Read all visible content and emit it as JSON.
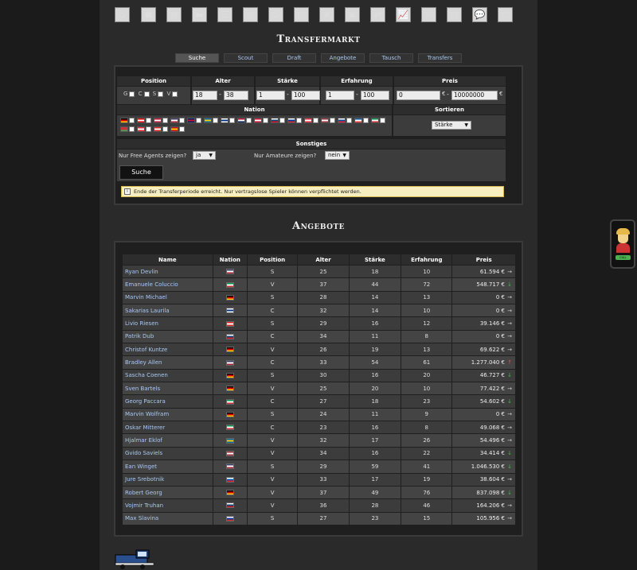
{
  "nav": {
    "icons": [
      {
        "name": "home-icon",
        "glyph": "⌂"
      },
      {
        "name": "team-icon",
        "glyph": "☗"
      },
      {
        "name": "lineup-icon",
        "glyph": "▦"
      },
      {
        "name": "training-icon",
        "glyph": "▬"
      },
      {
        "name": "list-icon",
        "glyph": "☰"
      },
      {
        "name": "scouting-icon",
        "glyph": "◎"
      },
      {
        "name": "youth-icon",
        "glyph": "☺"
      },
      {
        "name": "arena-icon",
        "glyph": "▤"
      },
      {
        "name": "trophy-icon",
        "glyph": "♛"
      },
      {
        "name": "tv-icon",
        "glyph": "▣"
      },
      {
        "name": "transfer-icon",
        "glyph": "⇄"
      },
      {
        "name": "stats-icon",
        "glyph": "📈"
      },
      {
        "name": "mail-icon",
        "glyph": "✉"
      },
      {
        "name": "news-icon",
        "glyph": "▥"
      },
      {
        "name": "forum-icon",
        "glyph": "💬"
      },
      {
        "name": "logout-icon",
        "glyph": "⏻"
      }
    ]
  },
  "title": "Transfermarkt",
  "tabs": [
    {
      "label": "Suche",
      "active": true
    },
    {
      "label": "Scout",
      "active": false
    },
    {
      "label": "Draft",
      "active": false
    },
    {
      "label": "Angebote",
      "active": false
    },
    {
      "label": "Tausch",
      "active": false
    },
    {
      "label": "Transfers",
      "active": false
    }
  ],
  "search": {
    "headers": {
      "position": "Position",
      "alter": "Alter",
      "staerke": "Stärke",
      "erfahrung": "Erfahrung",
      "preis": "Preis",
      "nation": "Nation",
      "sortieren": "Sortieren",
      "sonstiges": "Sonstiges"
    },
    "positions": [
      "G",
      "C",
      "S",
      "V"
    ],
    "alter_min": "18",
    "alter_max": "38",
    "staerke_min": "1",
    "staerke_max": "100",
    "erfahrung_min": "1",
    "erfahrung_max": "100",
    "preis_min": "0",
    "preis_max": "10000000",
    "currency": "€",
    "dash": "-",
    "sort_value": "Stärke",
    "free_agents_label": "Nur Free Agents zeigen?",
    "free_agents_value": "ja",
    "amateure_label": "Nur Amateure zeigen?",
    "amateure_value": "nein",
    "button": "Suche",
    "notice": "Ende der Transferperiode erreicht. Nur vertragslose Spieler können verpflichtet werden.",
    "info_glyph": "i"
  },
  "nation_flags": [
    {
      "code": "DE",
      "colors": [
        "#000",
        "#d00",
        "#fc0"
      ]
    },
    {
      "code": "CA",
      "colors": [
        "#d00",
        "#fff",
        "#d00"
      ]
    },
    {
      "code": "DK",
      "colors": [
        "#c60c30",
        "#fff",
        "#c60c30"
      ]
    },
    {
      "code": "US",
      "colors": [
        "#3c3b6e",
        "#fff",
        "#b22234"
      ]
    },
    {
      "code": "GB",
      "colors": [
        "#012169",
        "#c8102e",
        "#012169"
      ]
    },
    {
      "code": "SE",
      "colors": [
        "#006aa7",
        "#fecc00",
        "#006aa7"
      ]
    },
    {
      "code": "FI",
      "colors": [
        "#fff",
        "#003580",
        "#fff"
      ]
    },
    {
      "code": "NO",
      "colors": [
        "#ba0c2f",
        "#fff",
        "#00205b"
      ]
    },
    {
      "code": "DK2",
      "colors": [
        "#c60c30",
        "#fff",
        "#c60c30"
      ]
    },
    {
      "code": "CZ",
      "colors": [
        "#fff",
        "#11457e",
        "#d7141a"
      ]
    },
    {
      "code": "RU",
      "colors": [
        "#fff",
        "#0039a6",
        "#d52b1e"
      ]
    },
    {
      "code": "AT",
      "colors": [
        "#ed2939",
        "#fff",
        "#ed2939"
      ]
    },
    {
      "code": "LV",
      "colors": [
        "#9e3039",
        "#fff",
        "#9e3039"
      ]
    },
    {
      "code": "SK",
      "colors": [
        "#fff",
        "#0b4ea2",
        "#ee1c25"
      ]
    },
    {
      "code": "FR",
      "colors": [
        "#0055a4",
        "#fff",
        "#ef4135"
      ]
    },
    {
      "code": "IT",
      "colors": [
        "#009246",
        "#fff",
        "#ce2b37"
      ]
    },
    {
      "code": "BY",
      "colors": [
        "#c8313e",
        "#c8313e",
        "#4aa657"
      ]
    },
    {
      "code": "AT2",
      "colors": [
        "#ed2939",
        "#fff",
        "#ed2939"
      ]
    },
    {
      "code": "CH",
      "colors": [
        "#d52b1e",
        "#fff",
        "#d52b1e"
      ]
    },
    {
      "code": "ES",
      "colors": [
        "#c60b1e",
        "#ffc400",
        "#c60b1e"
      ]
    }
  ],
  "offers": {
    "title": "Angebote",
    "columns": [
      "Name",
      "Nation",
      "Position",
      "Alter",
      "Stärke",
      "Erfahrung",
      "Preis"
    ],
    "rows": [
      {
        "name": "Ryan Devlin",
        "flag": "US",
        "pos": "S",
        "alter": "25",
        "staerke": "18",
        "erf": "10",
        "preis": "61.594 €",
        "trend": "→"
      },
      {
        "name": "Emanuele Coluccio",
        "flag": "IT",
        "pos": "V",
        "alter": "37",
        "staerke": "44",
        "erf": "72",
        "preis": "548.717 €",
        "trend": "↓"
      },
      {
        "name": "Marvin Michael",
        "flag": "DE",
        "pos": "S",
        "alter": "28",
        "staerke": "14",
        "erf": "13",
        "preis": "0 €",
        "trend": "→"
      },
      {
        "name": "Sakarias Laurila",
        "flag": "FI",
        "pos": "C",
        "alter": "32",
        "staerke": "14",
        "erf": "10",
        "preis": "0 €",
        "trend": "→"
      },
      {
        "name": "Livio Riesen",
        "flag": "CH",
        "pos": "S",
        "alter": "29",
        "staerke": "16",
        "erf": "12",
        "preis": "39.146 €",
        "trend": "→"
      },
      {
        "name": "Patrik Dub",
        "flag": "CZ",
        "pos": "C",
        "alter": "34",
        "staerke": "11",
        "erf": "8",
        "preis": "0 €",
        "trend": "→"
      },
      {
        "name": "Christof Kuntze",
        "flag": "DE",
        "pos": "V",
        "alter": "26",
        "staerke": "19",
        "erf": "13",
        "preis": "69.622 €",
        "trend": "→"
      },
      {
        "name": "Bradley Allen",
        "flag": "US",
        "pos": "C",
        "alter": "33",
        "staerke": "54",
        "erf": "61",
        "preis": "1.277.040 €",
        "trend": "↑"
      },
      {
        "name": "Sascha Coenen",
        "flag": "DE",
        "pos": "S",
        "alter": "30",
        "staerke": "16",
        "erf": "20",
        "preis": "46.727 €",
        "trend": "↓"
      },
      {
        "name": "Sven Bartels",
        "flag": "DE",
        "pos": "V",
        "alter": "25",
        "staerke": "20",
        "erf": "10",
        "preis": "77.422 €",
        "trend": "→"
      },
      {
        "name": "Georg Paccara",
        "flag": "IT",
        "pos": "C",
        "alter": "27",
        "staerke": "18",
        "erf": "23",
        "preis": "54.602 €",
        "trend": "↓"
      },
      {
        "name": "Marvin Wolfram",
        "flag": "DE",
        "pos": "S",
        "alter": "24",
        "staerke": "11",
        "erf": "9",
        "preis": "0 €",
        "trend": "→"
      },
      {
        "name": "Oskar Mitterer",
        "flag": "IT",
        "pos": "C",
        "alter": "23",
        "staerke": "16",
        "erf": "8",
        "preis": "49.068 €",
        "trend": "→"
      },
      {
        "name": "Hjalmar Eklof",
        "flag": "SE",
        "pos": "V",
        "alter": "32",
        "staerke": "17",
        "erf": "26",
        "preis": "54.496 €",
        "trend": "→"
      },
      {
        "name": "Gvido Saviels",
        "flag": "LV",
        "pos": "V",
        "alter": "34",
        "staerke": "16",
        "erf": "22",
        "preis": "34.414 €",
        "trend": "↓"
      },
      {
        "name": "Ean Winget",
        "flag": "US",
        "pos": "S",
        "alter": "29",
        "staerke": "59",
        "erf": "41",
        "preis": "1.046.530 €",
        "trend": "↓"
      },
      {
        "name": "Jure Srebotnik",
        "flag": "SI",
        "pos": "V",
        "alter": "33",
        "staerke": "17",
        "erf": "19",
        "preis": "38.604 €",
        "trend": "→"
      },
      {
        "name": "Robert Georg",
        "flag": "DE",
        "pos": "V",
        "alter": "37",
        "staerke": "49",
        "erf": "76",
        "preis": "837.098 €",
        "trend": "↓"
      },
      {
        "name": "Vojmir Truhan",
        "flag": "CZ",
        "pos": "V",
        "alter": "36",
        "staerke": "28",
        "erf": "46",
        "preis": "164.206 €",
        "trend": "→"
      },
      {
        "name": "Max Slavina",
        "flag": "RU",
        "pos": "S",
        "alter": "27",
        "staerke": "23",
        "erf": "15",
        "preis": "105.956 €",
        "trend": "→"
      }
    ]
  },
  "flag_colors": {
    "US": [
      "#3c3b6e",
      "#fff",
      "#b22234"
    ],
    "IT": [
      "#009246",
      "#fff",
      "#ce2b37"
    ],
    "DE": [
      "#000",
      "#d00",
      "#fc0"
    ],
    "FI": [
      "#fff",
      "#003580",
      "#fff"
    ],
    "CH": [
      "#d52b1e",
      "#fff",
      "#d52b1e"
    ],
    "CZ": [
      "#fff",
      "#11457e",
      "#d7141a"
    ],
    "SE": [
      "#006aa7",
      "#fecc00",
      "#006aa7"
    ],
    "LV": [
      "#9e3039",
      "#fff",
      "#9e3039"
    ],
    "SI": [
      "#fff",
      "#0057b8",
      "#ed1c24"
    ],
    "RU": [
      "#fff",
      "#0039a6",
      "#d52b1e"
    ]
  },
  "trend_colors": {
    "→": "#cccccc",
    "↓": "#3cbf3c",
    "↑": "#e05050"
  },
  "side_widget": {
    "call_label": "CALL"
  }
}
